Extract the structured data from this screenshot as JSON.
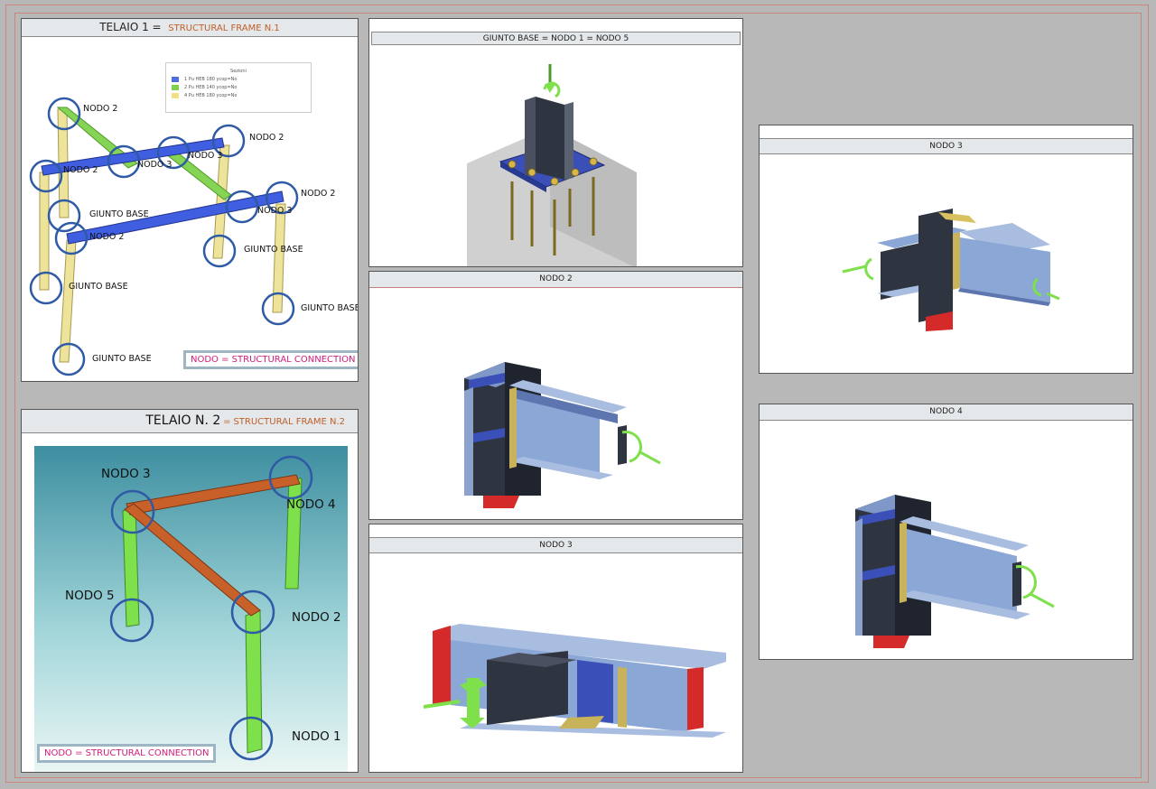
{
  "colors": {
    "beam_blue": "#3e5bd6",
    "beam_green": "#7fd04a",
    "column_yellow": "#e8dc8a",
    "frame2_orange": "#c8602a",
    "frame2_green": "#7ee04a",
    "accent_pink": "#d01e7a",
    "circle_blue": "#2f5aa6"
  },
  "frame1": {
    "title": "TELAIO 1 =",
    "subtitle": "STRUCTURAL FRAME N.1",
    "legend": {
      "title": "Sezioni",
      "items": [
        {
          "label": "1 Pu HEB 180 ycop=No",
          "color": "#4f6fe0"
        },
        {
          "label": "2 Pu HEB 140 ycop=No",
          "color": "#7fd04a"
        },
        {
          "label": "4 Pu HEB 180 ycop=No",
          "color": "#f0e08a"
        }
      ]
    },
    "labels": {
      "n2a": "NODO 2",
      "n2b": "NODO 2",
      "n3a": "NODO 3",
      "n3b": "NODO 3",
      "n2c": "NODO 2",
      "n2d": "NODO 2",
      "n3c": "NODO 3",
      "n2e": "NODO 2",
      "gb1": "GIUNTO BASE",
      "gb2": "GIUNTO BASE",
      "gb3": "GIUNTO BASE",
      "gb4": "GIUNTO BASE",
      "gb5": "GIUNTO BASE"
    },
    "callout": "NODO =  STRUCTURAL CONNECTION"
  },
  "frame2": {
    "title": "TELAIO N. 2",
    "eq": "=",
    "subtitle": "STRUCTURAL FRAME N.2",
    "labels": {
      "n3": "NODO 3",
      "n4": "NODO 4",
      "n5": "NODO 5",
      "n2": "NODO 2",
      "n1": "NODO 1"
    },
    "callout": "NODO =  STRUCTURAL CONNECTION"
  },
  "panels": {
    "base": "GIUNTO BASE = NODO 1 =  NODO 5",
    "nodo2": "NODO 2",
    "nodo3_bottom": "NODO 3",
    "nodo3_right": "NODO 3",
    "nodo4": "NODO 4"
  }
}
